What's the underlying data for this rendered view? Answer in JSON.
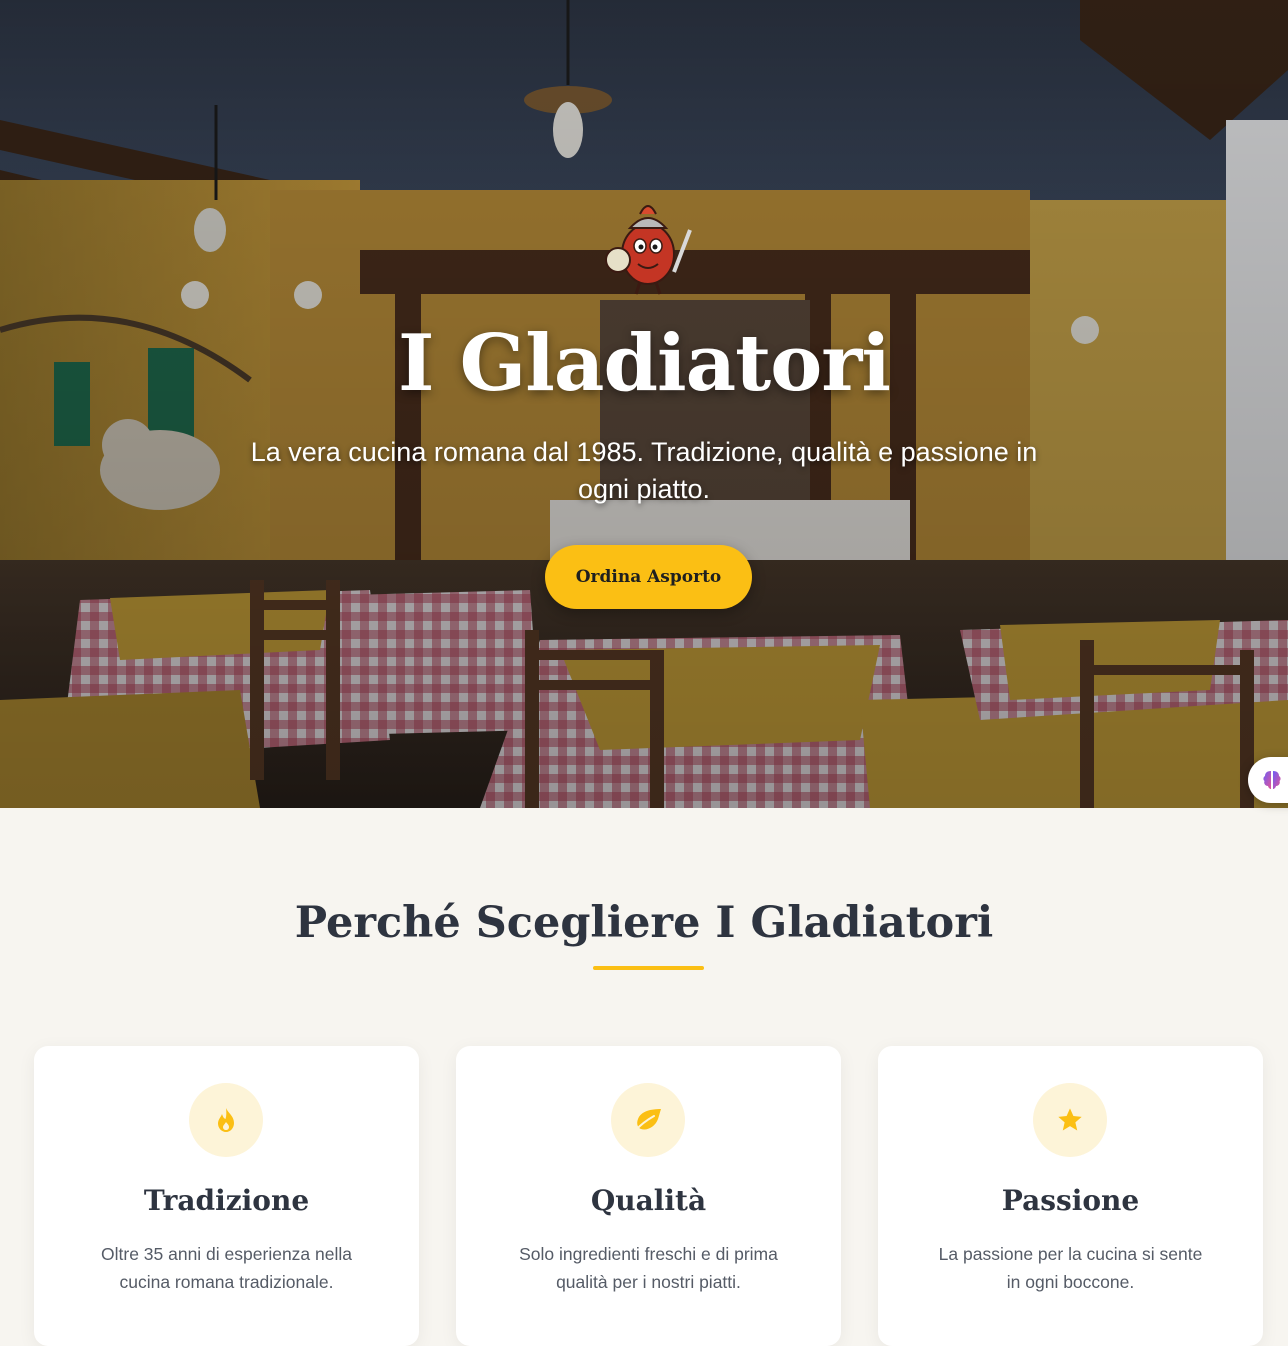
{
  "hero": {
    "title": "I Gladiatori",
    "subtitle": "La vera cucina romana dal 1985. Tradizione, qualità e passione in ogni piatto.",
    "cta_label": "Ordina Asporto"
  },
  "features": {
    "title": "Perché Scegliere I Gladiatori",
    "cards": [
      {
        "icon": "fire-icon",
        "title": "Tradizione",
        "text": "Oltre 35 anni di esperienza nella cucina romana tradizionale."
      },
      {
        "icon": "leaf-icon",
        "title": "Qualità",
        "text": "Solo ingredienti freschi e di prima qualità per i nostri piatti."
      },
      {
        "icon": "star-icon",
        "title": "Passione",
        "text": "La passione per la cucina si sente in ogni boccone."
      }
    ]
  },
  "colors": {
    "accent": "#fbbf14",
    "heading": "#2e3440",
    "body_text": "#555b66",
    "background": "#f7f5f0",
    "icon_bg": "#fdf4d8"
  }
}
